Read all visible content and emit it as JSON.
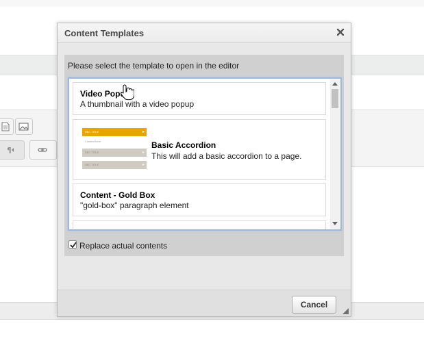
{
  "dialog": {
    "title": "Content Templates",
    "close_icon": "close-icon",
    "prompt": "Please select the template to open in the editor",
    "templates": [
      {
        "title": "Video Popup",
        "description": "A thumbnail with a video popup"
      },
      {
        "title": "Basic Accordion",
        "description": "This will add a basic accordion to a page.",
        "thumbnail": "accordion-thumbnail"
      },
      {
        "title": "Content - Gold Box",
        "description": "\"gold-box\" paragraph element"
      }
    ],
    "replace_label": "Replace actual contents",
    "replace_checked": true,
    "cancel_label": "Cancel"
  },
  "colors": {
    "accordion_gold": "#e8a500",
    "accordion_gray": "#cfcbc2",
    "focus_border": "#9cb7e0"
  }
}
